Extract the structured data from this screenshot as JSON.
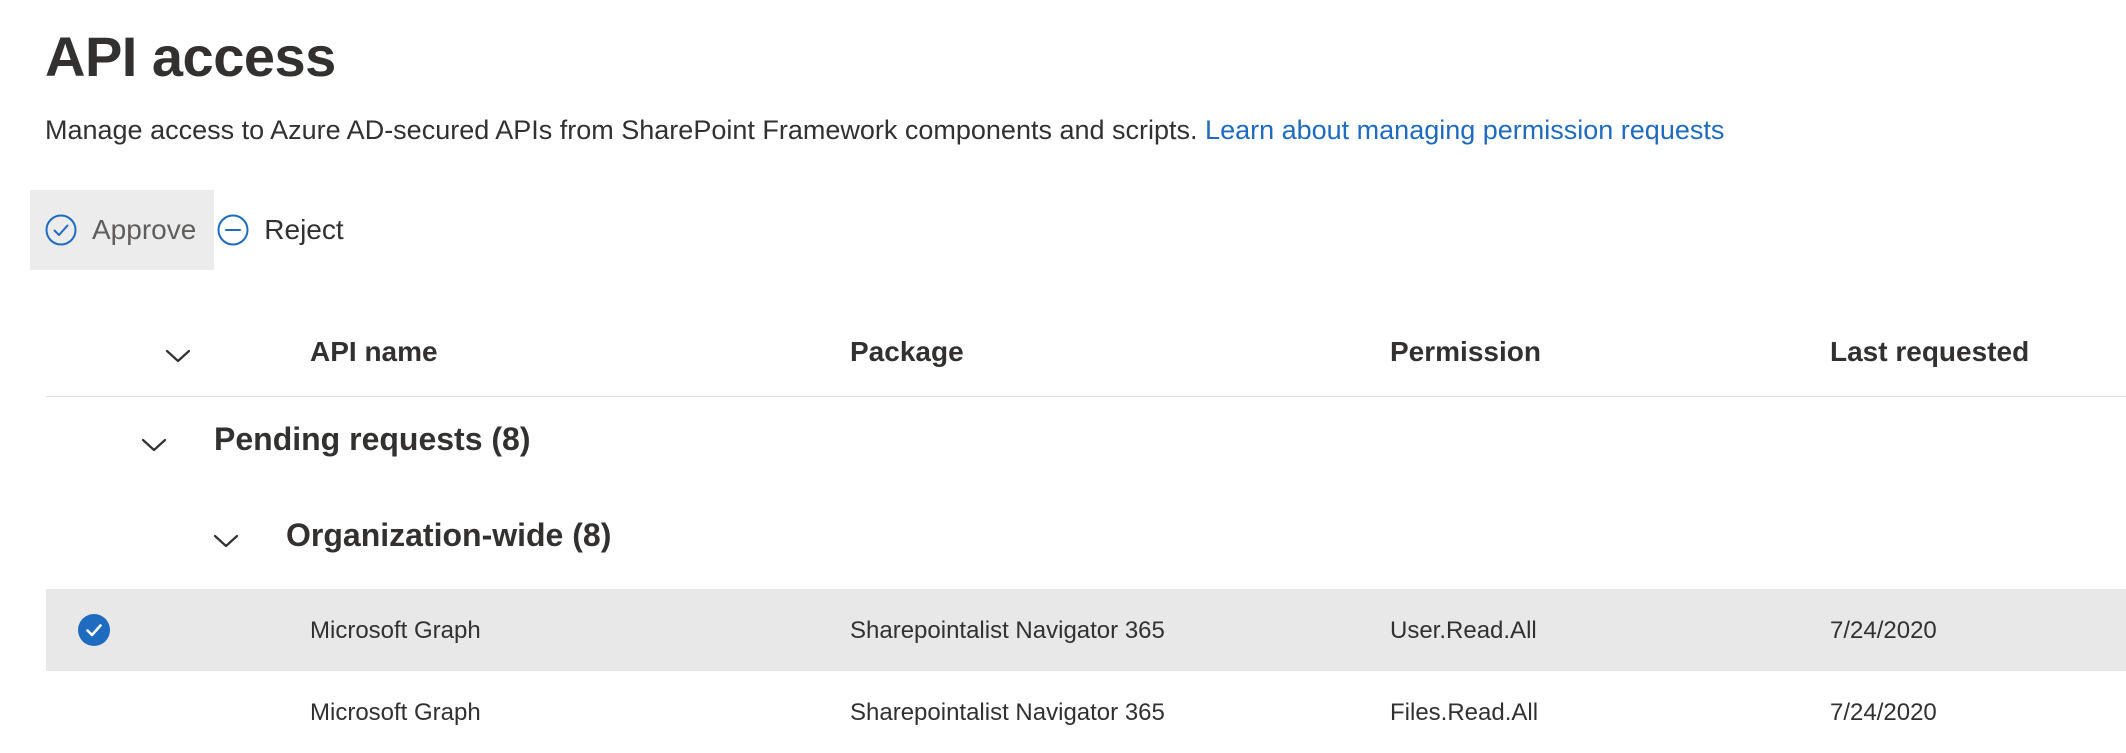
{
  "page": {
    "title": "API access",
    "description": "Manage access to Azure AD-secured APIs from SharePoint Framework components and scripts.",
    "learn_link": "Learn about managing permission requests"
  },
  "toolbar": {
    "approve_label": "Approve",
    "reject_label": "Reject",
    "approve_icon": "check-circle-icon",
    "reject_icon": "minus-circle-icon"
  },
  "table": {
    "columns": {
      "api_name": "API name",
      "package": "Package",
      "permission": "Permission",
      "last_requested": "Last requested"
    },
    "groups": [
      {
        "title": "Pending requests (8)",
        "subgroups": [
          {
            "title": "Organization-wide (8)",
            "rows": [
              {
                "api_name": "Microsoft Graph",
                "package": "Sharepointalist Navigator 365",
                "permission": "User.Read.All",
                "last_requested": "7/24/2020",
                "selected": true
              },
              {
                "api_name": "Microsoft Graph",
                "package": "Sharepointalist Navigator 365",
                "permission": "Files.Read.All",
                "last_requested": "7/24/2020",
                "selected": false
              }
            ]
          }
        ]
      }
    ]
  },
  "colors": {
    "accent": "#1f6bbf",
    "selected_row_bg": "#e8e8e8",
    "pressed_button_bg": "#ececec"
  }
}
